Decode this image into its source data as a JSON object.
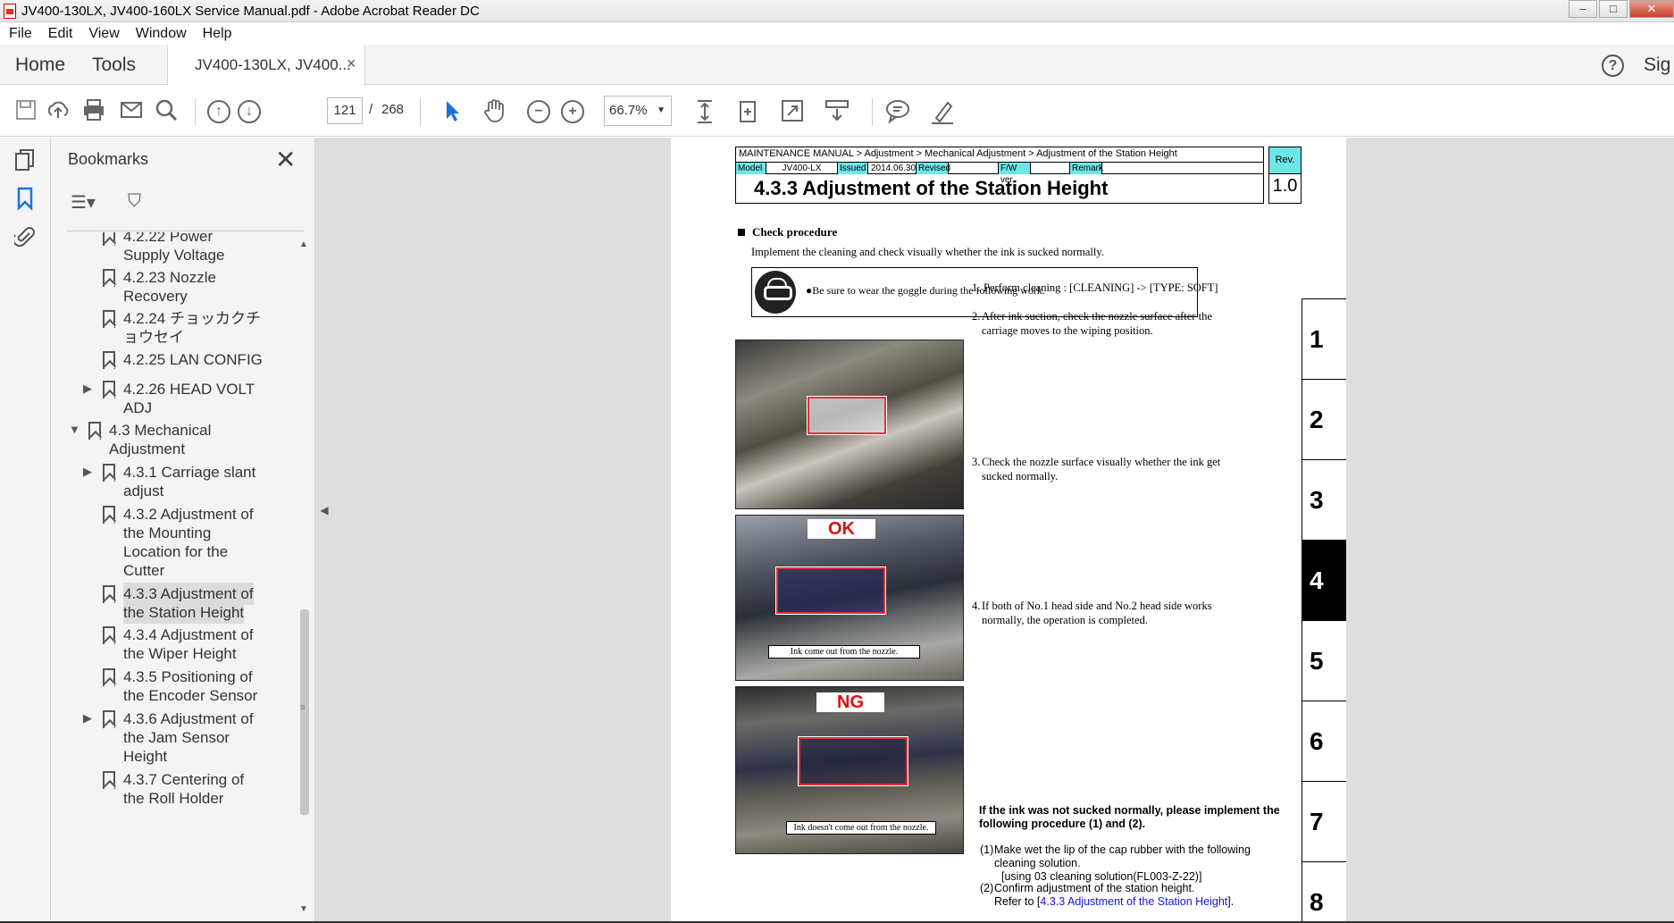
{
  "window": {
    "title": "JV400-130LX, JV400-160LX Service Manual.pdf - Adobe Acrobat Reader DC",
    "controls": [
      "minimize",
      "maximize",
      "close"
    ]
  },
  "menu": [
    "File",
    "Edit",
    "View",
    "Window",
    "Help"
  ],
  "tabs": {
    "home": "Home",
    "tools": "Tools",
    "document": "JV400-130LX, JV400...",
    "close_symbol": "×",
    "sign": "Sig"
  },
  "toolbar": {
    "current_page": "121",
    "separator": "/",
    "total_pages": "268",
    "zoom": "66.7%"
  },
  "bookmarks": {
    "title": "Bookmarks",
    "items": [
      {
        "label": "4.2.22 Power Supply Voltage",
        "lines": [
          "4.2.22 Power",
          "Supply Voltage"
        ]
      },
      {
        "label": "4.2.23 Nozzle Recovery",
        "lines": [
          "4.2.23 Nozzle",
          "Recovery"
        ]
      },
      {
        "label": "4.2.24 チョッカクチョウセイ",
        "lines": [
          "4.2.24 チョッカクチ",
          "ョウセイ"
        ]
      },
      {
        "label": "4.2.25 LAN CONFIG",
        "lines": [
          "4.2.25 LAN CONFIG"
        ]
      },
      {
        "label": "4.2.26 HEAD VOLT ADJ",
        "lines": [
          "4.2.26 HEAD VOLT",
          "ADJ"
        ]
      },
      {
        "label": "4.3 Mechanical Adjustment",
        "lines": [
          "4.3 Mechanical",
          "Adjustment"
        ]
      },
      {
        "label": "4.3.1 Carriage slant adjust",
        "lines": [
          "4.3.1 Carriage slant",
          "adjust"
        ]
      },
      {
        "label": "4.3.2 Adjustment of the Mounting Location for the Cutter",
        "lines": [
          "4.3.2 Adjustment of",
          "the Mounting",
          "Location for the",
          "Cutter"
        ]
      },
      {
        "label": "4.3.3 Adjustment of the Station Height",
        "lines": [
          "4.3.3 Adjustment of",
          "the Station Height"
        ]
      },
      {
        "label": "4.3.4 Adjustment of the Wiper Height",
        "lines": [
          "4.3.4 Adjustment of",
          "the Wiper Height"
        ]
      },
      {
        "label": "4.3.5 Positioning of the Encoder Sensor",
        "lines": [
          "4.3.5 Positioning of",
          "the Encoder Sensor"
        ]
      },
      {
        "label": "4.3.6 Adjustment of the Jam Sensor Height",
        "lines": [
          "4.3.6 Adjustment of",
          "the Jam Sensor",
          "Height"
        ]
      },
      {
        "label": "4.3.7 Centering of the Roll Holder",
        "lines": [
          "4.3.7 Centering of",
          "the Roll Holder"
        ]
      }
    ]
  },
  "document": {
    "breadcrumb": "MAINTENANCE MANUAL > Adjustment > Mechanical Adjustment > Adjustment of the Station Height",
    "model_label": "Model",
    "model": "JV400-LX",
    "issued_label": "Issued",
    "issued": "2014.06.30",
    "revised_label": "Revised",
    "fw_label": "F/W ver.",
    "remark_label": "Remark",
    "rev_label": "Rev.",
    "rev": "1.0",
    "section_title": "4.3.3  Adjustment of the Station Height",
    "check_heading": "Check procedure",
    "intro": "Implement the cleaning and check visually whether the ink is sucked normally.",
    "warning": "●Be sure to wear the goggle during the following work.",
    "steps": [
      {
        "n": "1.",
        "text": "Perform cleaning : [CLEANING] -> [TYPE: SOFT]"
      },
      {
        "n": "2.",
        "text": "After ink suction, check the nozzle surface after the carriage moves to the wiping position."
      },
      {
        "n": "3.",
        "text": "Check the nozzle surface visually whether the ink get sucked normally."
      },
      {
        "n": "4.",
        "text": "If both of No.1 head side and No.2 head side works normally, the operation is completed."
      }
    ],
    "ok_label": "OK",
    "ok_caption": "Ink come out from the nozzle.",
    "ng_label": "NG",
    "ng_caption": "Ink doesn't come out from the nozzle.",
    "if_not": "If the ink was not sucked normally, please implement the following procedure (1) and (2).",
    "proc1_n": "(1)",
    "proc1": "Make wet the lip of the cap rubber with the following cleaning solution.",
    "proc1_sub": "[using 03 cleaning solution(FL003-Z-22)]",
    "proc2_n": "(2)",
    "proc2": "Confirm adjustment of the station height.",
    "proc2_ref_prefix": "Refer to [",
    "proc2_link": "4.3.3 Adjustment of the Station Height",
    "proc2_ref_suffix": "].",
    "chapter_tabs": [
      "1",
      "2",
      "3",
      "4",
      "5",
      "6",
      "7",
      "8"
    ],
    "active_chapter": "4"
  },
  "colors": {
    "accent": "#1a73d9",
    "header_cyan": "#6fe6e6",
    "verdict_red": "#e01010",
    "link_blue": "#1515d8"
  }
}
